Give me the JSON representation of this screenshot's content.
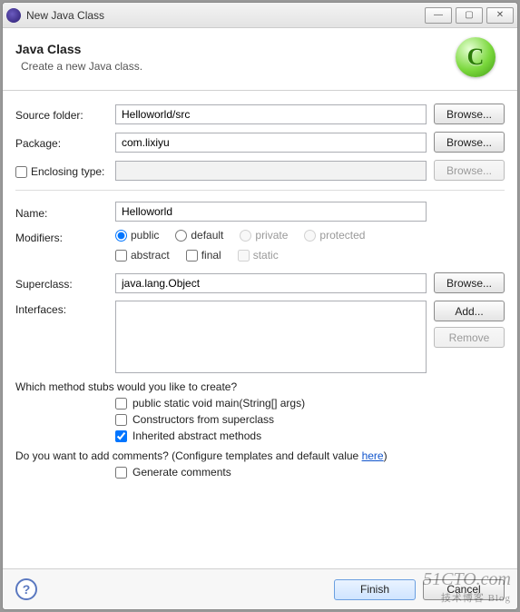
{
  "window": {
    "title": "New Java Class"
  },
  "banner": {
    "heading": "Java Class",
    "subtext": "Create a new Java class.",
    "icon_letter": "C"
  },
  "labels": {
    "source_folder": "Source folder:",
    "package": "Package:",
    "enclosing_type": "Enclosing type:",
    "name": "Name:",
    "modifiers": "Modifiers:",
    "superclass": "Superclass:",
    "interfaces": "Interfaces:"
  },
  "values": {
    "source_folder": "Helloworld/src",
    "package": "com.lixiyu",
    "enclosing_type": "",
    "name": "Helloworld",
    "superclass": "java.lang.Object"
  },
  "buttons": {
    "browse": "Browse...",
    "add": "Add...",
    "remove": "Remove",
    "finish": "Finish",
    "cancel": "Cancel"
  },
  "modifiers": {
    "radios": {
      "public": "public",
      "default": "default",
      "private": "private",
      "protected": "protected"
    },
    "checks": {
      "abstract": "abstract",
      "final": "final",
      "static": "static"
    },
    "selected_radio": "public",
    "abstract_checked": false,
    "final_checked": false,
    "static_checked": false,
    "static_enabled": false,
    "private_enabled": false,
    "protected_enabled": false
  },
  "questions": {
    "stubs": "Which method stubs would you like to create?",
    "comments_pre": "Do you want to add comments? (Configure templates and default value ",
    "comments_link": "here",
    "comments_post": ")"
  },
  "stubs": {
    "main": "public static void main(String[] args)",
    "constructors": "Constructors from superclass",
    "inherited": "Inherited abstract methods",
    "main_checked": false,
    "constructors_checked": false,
    "inherited_checked": true
  },
  "comments": {
    "generate": "Generate comments",
    "generate_checked": false
  },
  "enclosing_checked": false,
  "watermark": {
    "main": "51CTO.com",
    "sub": "技术博客  Blog"
  }
}
